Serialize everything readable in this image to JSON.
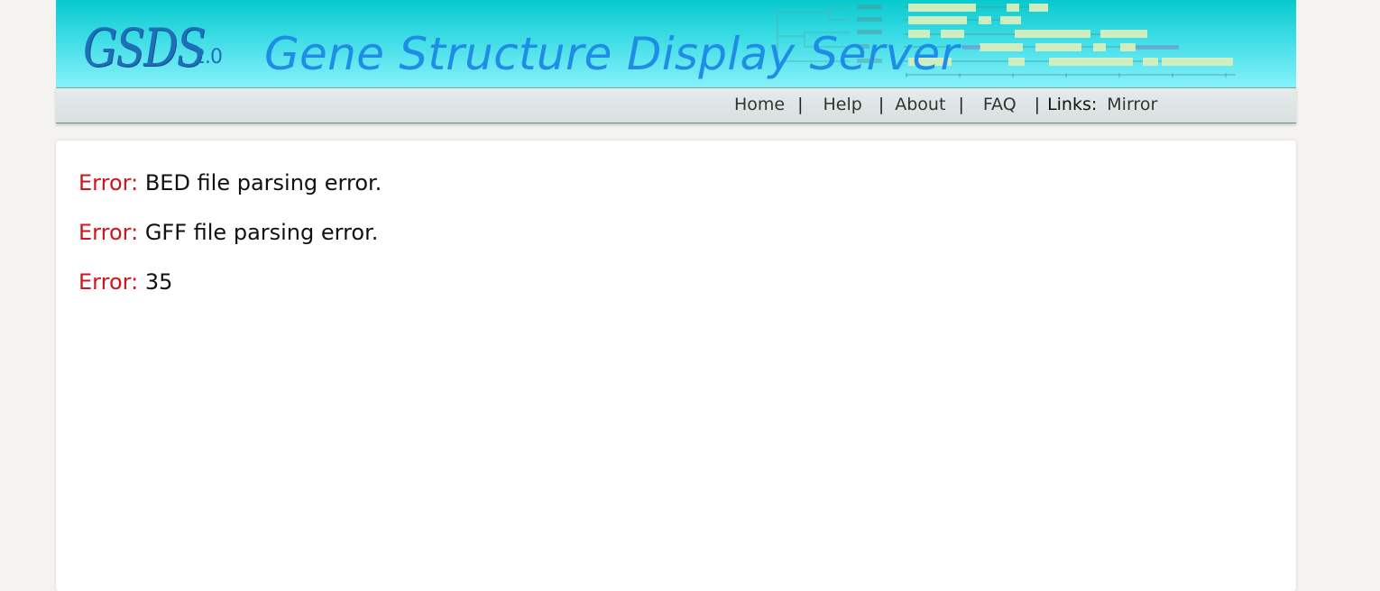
{
  "header": {
    "logo_main": "GSDS",
    "logo_version": "2.0",
    "title": "Gene Structure Display Server"
  },
  "nav": {
    "home": "Home",
    "help": "Help",
    "about": "About",
    "faq": "FAQ",
    "separator": "|",
    "links_label": "Links:",
    "mirror": "Mirror"
  },
  "errors": [
    {
      "label": "Error:",
      "message": "BED file parsing error."
    },
    {
      "label": "Error:",
      "message": "GFF file parsing error."
    },
    {
      "label": "Error:",
      "message": "35"
    }
  ],
  "colors": {
    "banner_top": "#07c9cd",
    "banner_bottom": "#86f1fb",
    "title": "#1f8de6",
    "error_label": "#d0141c",
    "page_bg": "#f4f3f0"
  }
}
